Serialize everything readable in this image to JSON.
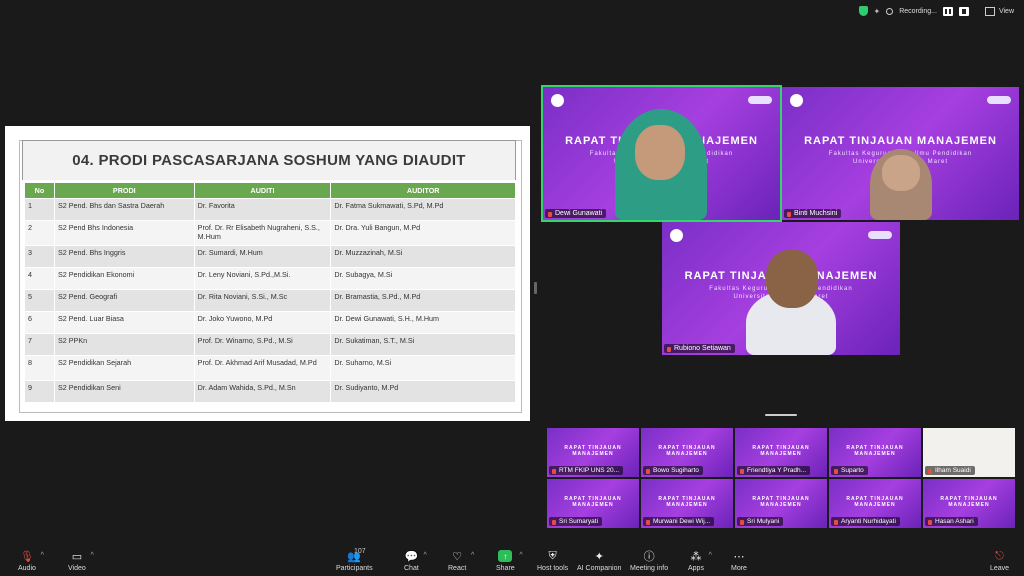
{
  "topbar": {
    "recording_label": "Recording...",
    "view_label": "View"
  },
  "slide": {
    "title": "04. PRODI PASCASARJANA SOSHUM YANG DIAUDIT",
    "headers": [
      "No",
      "PRODI",
      "AUDITI",
      "AUDITOR"
    ],
    "rows": [
      [
        "1",
        "S2 Pend. Bhs dan Sastra Daerah",
        "Dr. Favorita",
        "Dr. Fatma Sukmawati, S.Pd, M.Pd"
      ],
      [
        "2",
        "S2 Pend Bhs Indonesia",
        "Prof. Dr. Rr Elisabeth Nugraheni, S.S., M.Hum",
        "Dr. Dra. Yuli Bangun, M.Pd"
      ],
      [
        "3",
        "S2 Pend. Bhs Inggris",
        "Dr. Sumardi, M.Hum",
        "Dr. Muzzazinah, M.Si"
      ],
      [
        "4",
        "S2 Pendidikan Ekonomi",
        "Dr. Leny Noviani, S.Pd.,M.Si.",
        "Dr. Subagya, M.Si"
      ],
      [
        "5",
        "S2 Pend. Geografi",
        "Dr. Rita Noviani, S.Si., M.Sc",
        "Dr. Bramastia, S.Pd., M.Pd"
      ],
      [
        "6",
        "S2 Pend. Luar Biasa",
        "Dr. Joko Yuwono, M.Pd",
        "Dr. Dewi Gunawati, S.H., M.Hum"
      ],
      [
        "7",
        "S2 PPKn",
        "Prof. Dr. Winarno, S.Pd., M.Si",
        "Dr. Sukatiman, S.T., M.Si"
      ],
      [
        "8",
        "S2 Pendidikan Sejarah",
        "Prof. Dr. Akhmad Arif Musadad, M.Pd",
        "Dr. Suharno, M.Si"
      ],
      [
        "9",
        "S2 Pendidikan Seni",
        "Dr. Adam Wahida, S.Pd., M.Sn",
        "Dr. Sudiyanto, M.Pd"
      ]
    ]
  },
  "background_text": {
    "title": "RAPAT TINJAUAN MANAJEMEN",
    "subtitle_1": "Fakultas Keguruan dan Ilmu Pendidikan",
    "subtitle_2": "Universitas Sebelas Maret"
  },
  "tiles_large": [
    {
      "name": "Dewi Gunawati"
    },
    {
      "name": "Binti Muchsini"
    },
    {
      "name": "Rubiono Setiawan"
    }
  ],
  "tiles_small": [
    {
      "name": "RTM FKIP UNS 20..."
    },
    {
      "name": "Bowo Sugiharto"
    },
    {
      "name": "Friendtiya Y Pradh..."
    },
    {
      "name": "Suparto"
    },
    {
      "name": "Ilham Suaidi"
    },
    {
      "name": "Sri Sumaryati"
    },
    {
      "name": "Murwani Dewi Wij..."
    },
    {
      "name": "Sri Mulyani"
    },
    {
      "name": "Aryanti Nurhidayati"
    },
    {
      "name": "Hasan Ashari"
    }
  ],
  "toolbar": {
    "audio": "Audio",
    "video": "Video",
    "participants": "Participants",
    "participants_count": "107",
    "chat": "Chat",
    "react": "React",
    "share": "Share",
    "host_tools": "Host tools",
    "ai_companion": "AI Companion",
    "meeting_info": "Meeting info",
    "apps": "Apps",
    "more": "More",
    "leave": "Leave"
  },
  "colors": {
    "accent_green": "#32d66b",
    "table_header": "#6aa84f",
    "tile_purple": "#8e34d4"
  },
  "icons": [
    "shield-icon",
    "record-icon",
    "pause-icon",
    "stop-icon",
    "view-icon",
    "mic-muted-icon",
    "video-off-icon",
    "participants-icon",
    "chat-icon",
    "react-icon",
    "share-icon",
    "host-tools-icon",
    "ai-companion-icon",
    "info-icon",
    "apps-icon",
    "more-icon",
    "leave-icon"
  ]
}
